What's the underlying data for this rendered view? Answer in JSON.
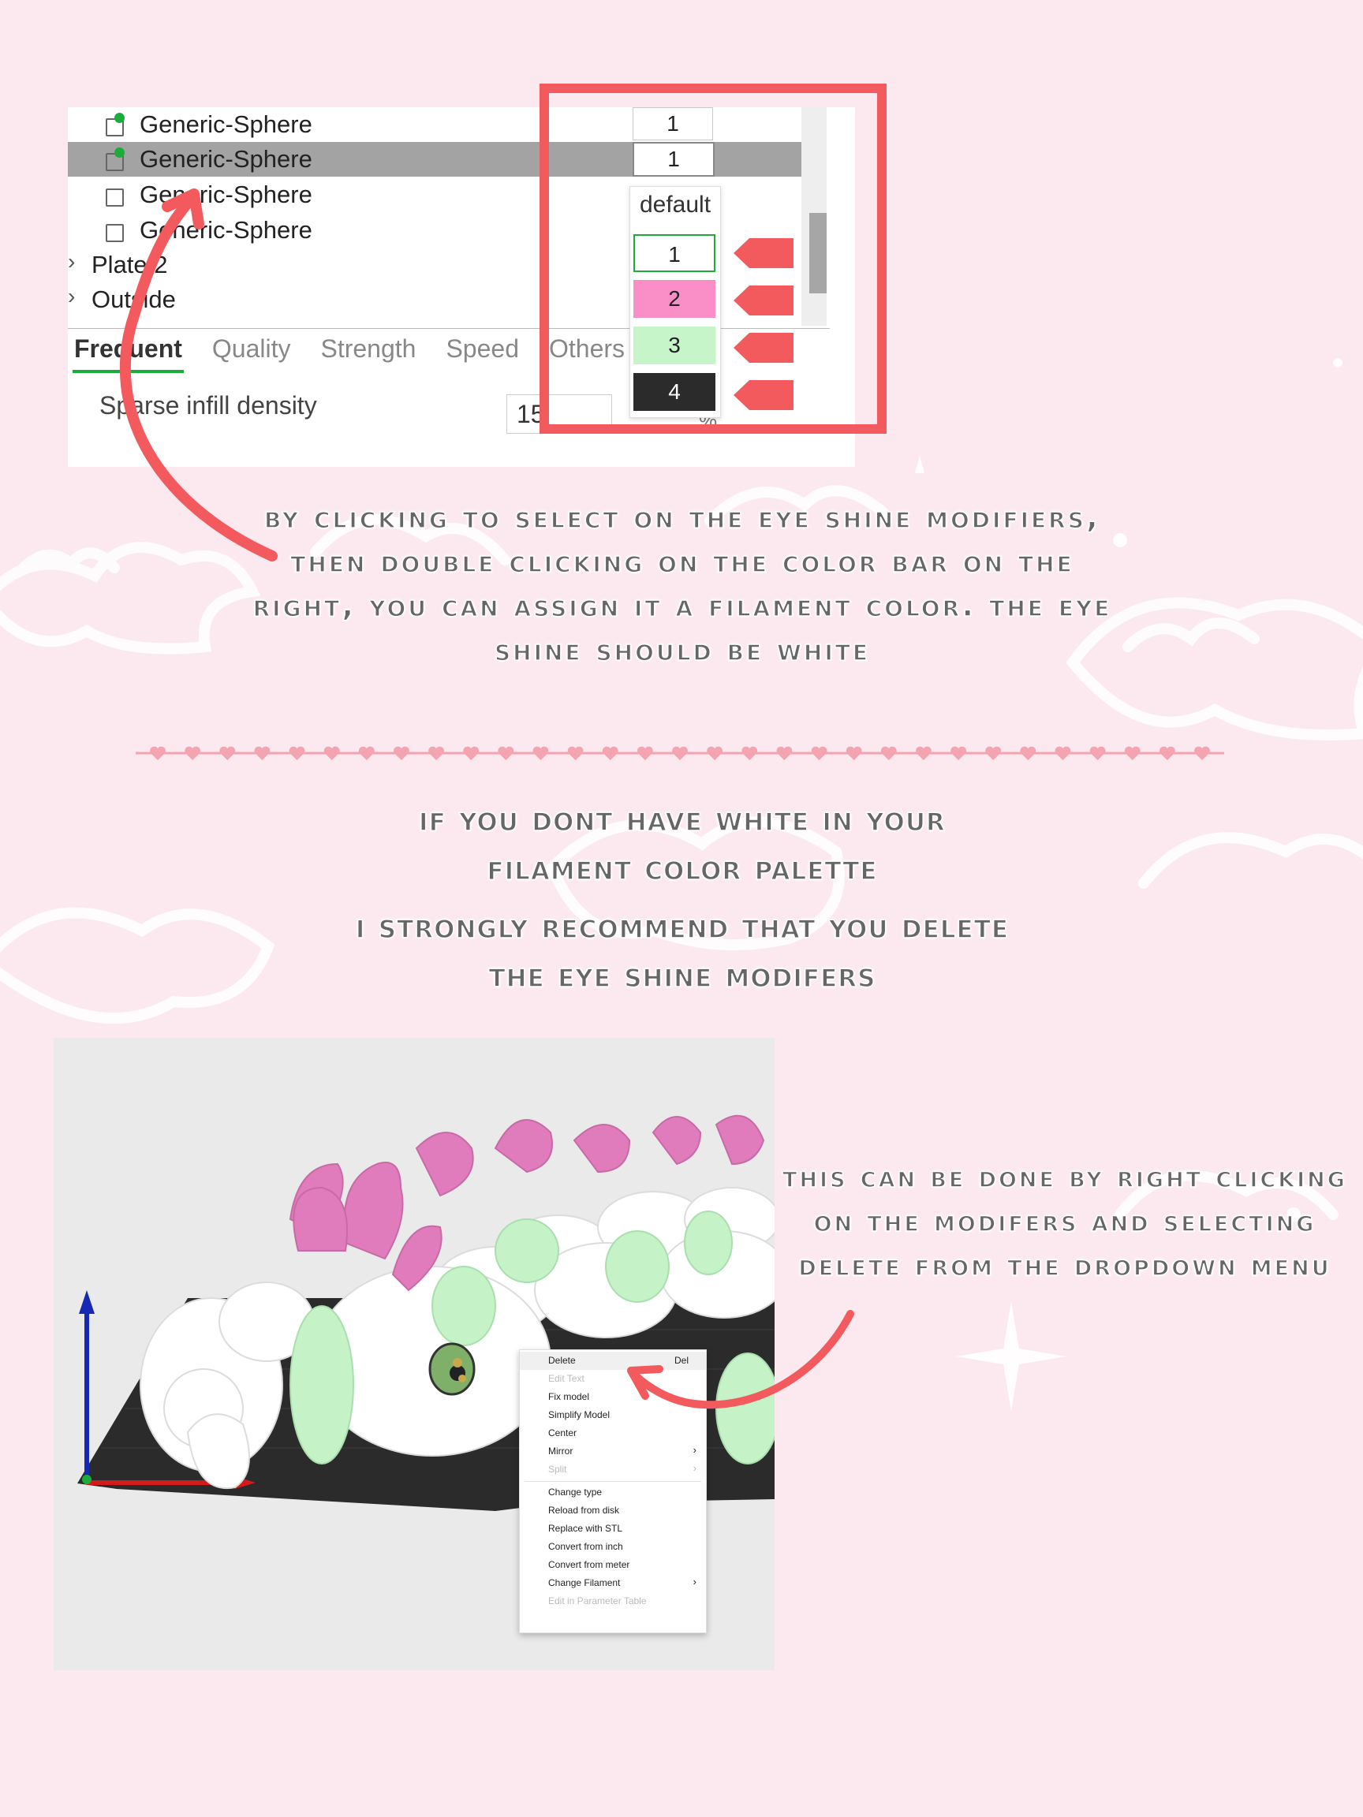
{
  "colors": {
    "background": "#fce9f0",
    "accent_red": "#f25a5e",
    "selection_green": "#1aad3c",
    "text_grey": "#666666",
    "heart_pink": "#f4a3b0"
  },
  "tree": {
    "rows": [
      {
        "label": "Generic-Sphere",
        "value": "1",
        "selected": false
      },
      {
        "label": "Generic-Sphere",
        "value": "1",
        "selected": true
      },
      {
        "label": "Generic-Sphere",
        "value": "",
        "selected": false
      },
      {
        "label": "Generic-Sphere",
        "value": "",
        "selected": false
      }
    ],
    "plates": [
      {
        "label": "Plate 2",
        "icon": "chevron-right-icon"
      },
      {
        "label": "Outside",
        "icon": "chevron-right-icon"
      }
    ]
  },
  "tabs": [
    {
      "label": "Frequent",
      "active": true
    },
    {
      "label": "Quality",
      "active": false
    },
    {
      "label": "Strength",
      "active": false
    },
    {
      "label": "Speed",
      "active": false
    },
    {
      "label": "Others",
      "active": false
    }
  ],
  "parameter": {
    "label": "Sparse infill density",
    "value": "15",
    "unit": "%"
  },
  "filament_dropdown": {
    "default_label": "default",
    "options": [
      {
        "label": "1",
        "color": "#ffffff",
        "text_color": "#222222",
        "selected": true
      },
      {
        "label": "2",
        "color": "#f98fc6",
        "text_color": "#222222",
        "selected": false
      },
      {
        "label": "3",
        "color": "#c5f5c8",
        "text_color": "#222222",
        "selected": false
      },
      {
        "label": "4",
        "color": "#2b2b2b",
        "text_color": "#ffffff",
        "selected": false
      }
    ]
  },
  "instructions": {
    "step1": "By clicking to select on the eye shine modifiers, then double clicking on the color bar on the right, you can assign it a filament color. The eye shine should be white",
    "title_line1": "If you dont have white in your",
    "title_line2": "filament color palette",
    "title_line3": "I strongly recommend that you delete",
    "title_line4": "the eye shine modifers",
    "step2": "This can be done by right clicking on the modifers and selecting delete from the dropdown menu"
  },
  "context_menu": {
    "items": [
      {
        "label": "Delete",
        "shortcut": "Del",
        "disabled": false,
        "submenu": false,
        "hover": true
      },
      {
        "label": "Edit Text",
        "shortcut": "",
        "disabled": true,
        "submenu": false
      },
      {
        "label": "Fix model",
        "shortcut": "",
        "disabled": false,
        "submenu": false
      },
      {
        "label": "Simplify Model",
        "shortcut": "",
        "disabled": false,
        "submenu": false
      },
      {
        "label": "Center",
        "shortcut": "",
        "disabled": false,
        "submenu": false
      },
      {
        "label": "Mirror",
        "shortcut": "",
        "disabled": false,
        "submenu": true
      },
      {
        "label": "Split",
        "shortcut": "",
        "disabled": true,
        "submenu": true
      },
      {
        "label": "Change type",
        "shortcut": "",
        "disabled": false,
        "submenu": false,
        "separator_before": true
      },
      {
        "label": "Reload from disk",
        "shortcut": "",
        "disabled": false,
        "submenu": false
      },
      {
        "label": "Replace with STL",
        "shortcut": "",
        "disabled": false,
        "submenu": false
      },
      {
        "label": "Convert from inch",
        "shortcut": "",
        "disabled": false,
        "submenu": false
      },
      {
        "label": "Convert from meter",
        "shortcut": "",
        "disabled": false,
        "submenu": false
      },
      {
        "label": "Change Filament",
        "shortcut": "",
        "disabled": false,
        "submenu": true
      },
      {
        "label": "Edit in Parameter Table",
        "shortcut": "",
        "disabled": true,
        "submenu": false
      }
    ],
    "submenu_glyph": "›"
  },
  "icons": {
    "chevron_right": "›",
    "object": "object-icon",
    "arrow": "curved-arrow-icon",
    "heart": "heart-icon"
  }
}
